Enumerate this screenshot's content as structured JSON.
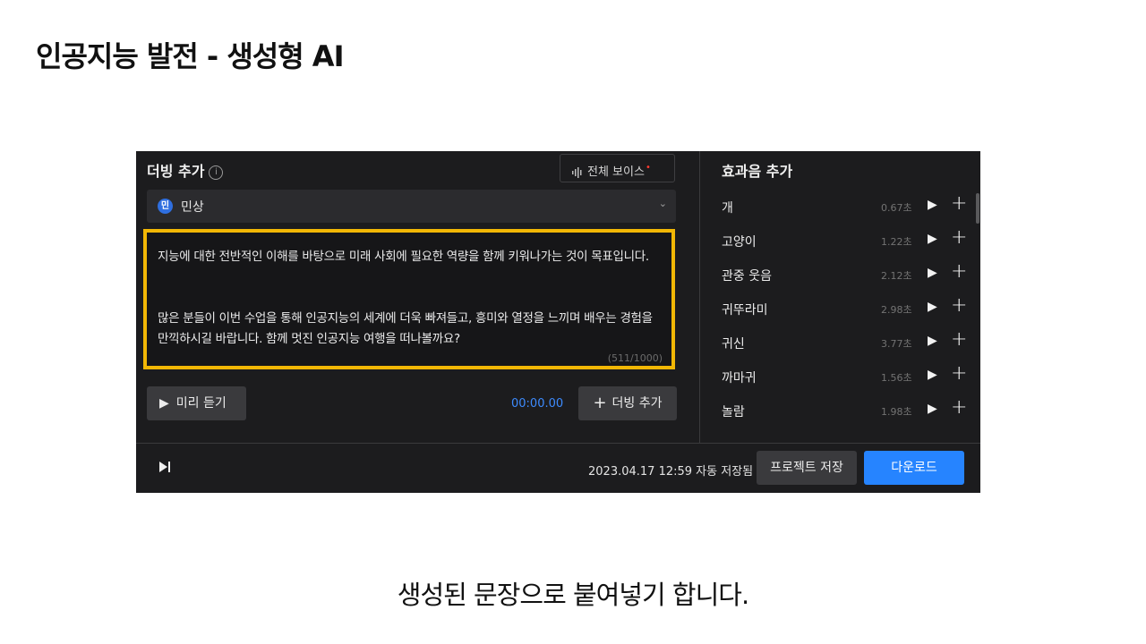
{
  "slide": {
    "title": "인공지능 발전 - 생성형 AI",
    "caption": "생성된 문장으로 붙여넣기 합니다."
  },
  "dubbing": {
    "title": "더빙 추가",
    "info_icon": "info-icon",
    "voice_button_label": "전체 보이스",
    "voice_button_badge": "•",
    "selected_voice": {
      "badge": "민",
      "name": "민상"
    },
    "script_paragraphs": [
      "지능에 대한 전반적인 이해를 바탕으로 미래 사회에 필요한 역량을 함께 키워나가는 것이 목표입니다.",
      "많은 분들이 이번 수업을 통해 인공지능의 세계에 더욱 빠져들고, 흥미와 열정을 느끼며 배우는 경험을 만끽하시길 바랍니다. 함께 멋진 인공지능 여행을 떠나볼까요?"
    ],
    "char_count": "(511/1000)",
    "preview_label": "미리 듣기",
    "time": "00:00.00",
    "add_dub_label": "더빙 추가"
  },
  "sfx": {
    "title": "효과음 추가",
    "items": [
      {
        "name": "개",
        "duration": "0.67초"
      },
      {
        "name": "고양이",
        "duration": "1.22초"
      },
      {
        "name": "관중 웃음",
        "duration": "2.12초"
      },
      {
        "name": "귀뚜라미",
        "duration": "2.98초"
      },
      {
        "name": "귀신",
        "duration": "3.77초"
      },
      {
        "name": "까마귀",
        "duration": "1.56초"
      },
      {
        "name": "놀람",
        "duration": "1.98초"
      }
    ]
  },
  "footer": {
    "saved_status": "2023.04.17 12:59 자동 저장됨",
    "save_project_label": "프로젝트 저장",
    "download_label": "다운로드"
  },
  "colors": {
    "accent": "#2684ff",
    "highlight": "#f2b705",
    "panel_bg": "#1c1c1e"
  }
}
